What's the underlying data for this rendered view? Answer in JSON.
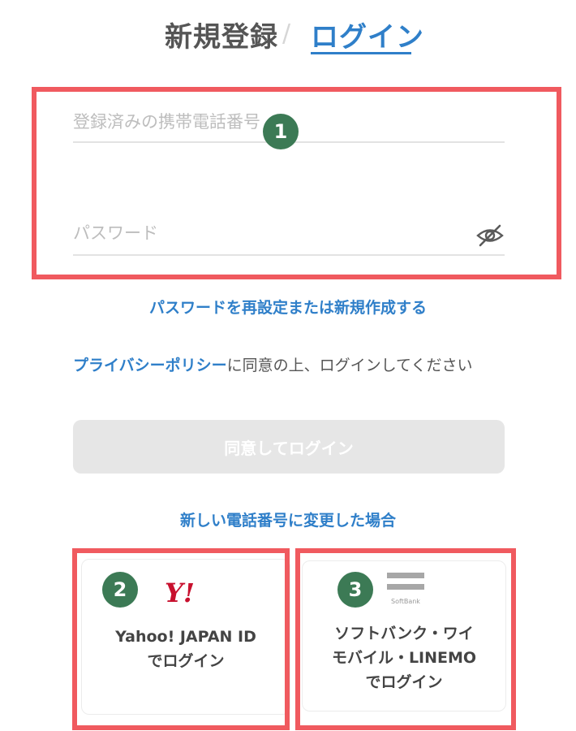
{
  "tabs": {
    "register_label": "新規登録",
    "separator": "/",
    "login_label": "ログイン"
  },
  "form": {
    "phone_placeholder": "登録済みの携帯電話番号",
    "password_placeholder": "パスワード",
    "password_visibility_icon": "eye-slash-icon"
  },
  "links": {
    "reset_password": "パスワードを再設定または新規作成する",
    "changed_number": "新しい電話番号に変更した場合"
  },
  "privacy": {
    "link_text": "プライバシーポリシー",
    "rest_text": "に同意の上、ログインしてください"
  },
  "buttons": {
    "login": "同意してログイン"
  },
  "cards": {
    "yahoo": {
      "logo_text": "Y!",
      "line1": "Yahoo! JAPAN ID",
      "line2": "でログイン"
    },
    "softbank": {
      "logo_text": "SoftBank",
      "line1": "ソフトバンク・ワイ",
      "line2": "モバイル・LINEMO",
      "line3": "でログイン"
    }
  },
  "annotations": {
    "badge_1": "1",
    "badge_2": "2",
    "badge_3": "3"
  },
  "colors": {
    "accent": "#2f7fc9",
    "highlight_frame": "#f05a5f",
    "badge": "#3c7a55",
    "disabled_button": "#e6e6e6",
    "yahoo_red": "#c8102e"
  }
}
